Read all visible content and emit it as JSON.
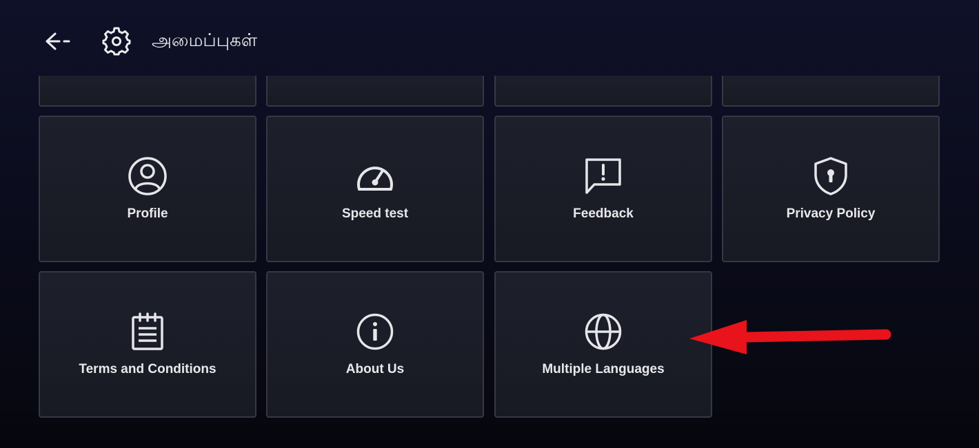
{
  "header": {
    "back_icon": "back-arrow-icon",
    "settings_icon": "gear-icon",
    "title": "அமைப்புகள்"
  },
  "tiles": [
    {
      "label": "Profile",
      "icon": "user-circle-icon"
    },
    {
      "label": "Speed test",
      "icon": "speedometer-icon"
    },
    {
      "label": "Feedback",
      "icon": "feedback-alert-icon"
    },
    {
      "label": "Privacy Policy",
      "icon": "shield-lock-icon"
    },
    {
      "label": "Terms and Conditions",
      "icon": "clipboard-icon"
    },
    {
      "label": "About Us",
      "icon": "info-circle-icon"
    },
    {
      "label": "Multiple Languages",
      "icon": "globe-icon"
    }
  ],
  "annotation": {
    "arrow_color": "#e8131b",
    "icon": "red-pointer-arrow-icon"
  },
  "colors": {
    "background_top": "#0f1128",
    "background_bottom": "#06070d",
    "tile_background": "#1b1d28",
    "tile_border": "#363846",
    "text": "#e9e9ec"
  }
}
